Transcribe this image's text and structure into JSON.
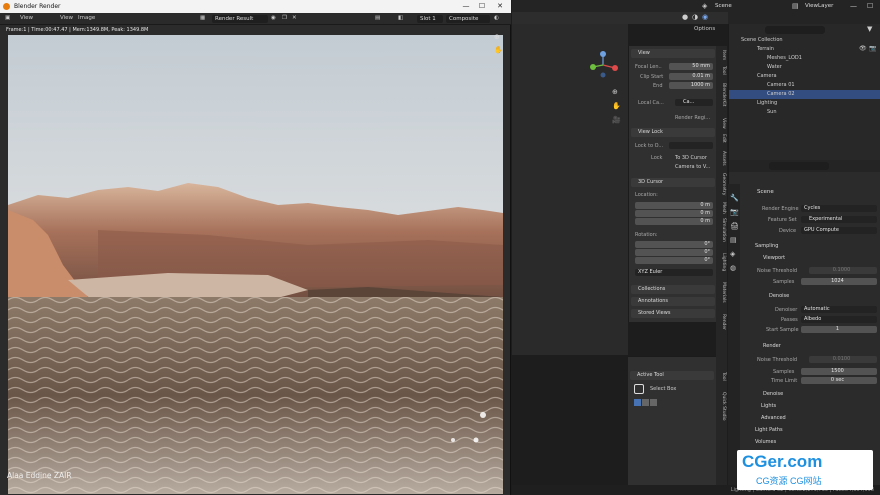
{
  "render_window": {
    "title": "Blender Render",
    "menu": {
      "view": "View",
      "view2": "View",
      "image": "Image"
    },
    "image_name": "Render Result",
    "slot": "Slot 1",
    "pass": "Composite",
    "info": "Frame:1 | Time:00:47.47 | Mem:1349.8M, Peak: 1349.8M",
    "credit": "Alaa Eddine ZAIR"
  },
  "topbar": {
    "scene": "Scene",
    "view_layer": "ViewLayer",
    "options": "Options"
  },
  "npanel": {
    "view_header": "View",
    "focal_label": "Focal Len..",
    "focal_value": "50 mm",
    "clip_start_label": "Clip Start",
    "clip_start_value": "0.01 m",
    "end_label": "End",
    "end_value": "1000 m",
    "local_camera_label": "Local Ca...",
    "local_camera_value": "Ca...",
    "render_region": "Render Regi...",
    "view_lock_header": "View Lock",
    "lock_to_object_label": "Lock to O...",
    "lock_label": "Lock",
    "lock_3d_cursor": "To 3D Cursor",
    "camera_to_view": "Camera to V...",
    "cursor_header": "3D Cursor",
    "location_label": "Location:",
    "loc_x": "0 m",
    "loc_y": "0 m",
    "loc_z": "0 m",
    "rotation_label": "Rotation:",
    "rot_x": "0°",
    "rot_y": "0°",
    "rot_z": "0°",
    "rotation_mode": "XYZ Euler",
    "collections": "Collections",
    "annotations": "Annotations",
    "stored_views": "Stored Views",
    "axis_x": "X",
    "axis_y": "Y",
    "axis_z": "Z"
  },
  "ntabs": [
    "Item",
    "Tool",
    "BlenderKit",
    "View",
    "Edit",
    "Assets",
    "Geometry",
    "Mesh",
    "Simulation",
    "Lighting",
    "Materials",
    "Render"
  ],
  "tool_panel": {
    "active_tool": "Active Tool",
    "select_box": "Select Box",
    "tabs": [
      "Tool",
      "Quick Studio"
    ]
  },
  "outliner": {
    "rows": [
      "Scene Collection",
      "Terrain",
      "Meshes_LOD1",
      "Water",
      "Camera",
      "Camera 01",
      "Camera 02",
      "Lighting",
      "Sun"
    ]
  },
  "properties": {
    "scene_name": "Scene",
    "render_engine_label": "Render Engine",
    "render_engine": "Cycles",
    "feature_set_label": "Feature Set",
    "feature_set": "Experimental",
    "device_label": "Device",
    "device": "GPU Compute",
    "sampling": "Sampling",
    "viewport": "Viewport",
    "noise_threshold_label": "Noise Threshold",
    "vp_noise_threshold": "0.1000",
    "samples_label": "Samples",
    "vp_samples": "1024",
    "denoise": "Denoise",
    "denoiser_label": "Denoiser",
    "denoiser": "Automatic",
    "passes_label": "Passes",
    "passes": "Albedo",
    "start_sample_label": "Start Sample",
    "start_sample": "1",
    "render": "Render",
    "r_noise_threshold": "0.0100",
    "r_samples": "1500",
    "time_limit_label": "Time Limit",
    "time_limit": "0 sec",
    "r_denoise": "Denoise",
    "light_tree": "Lights",
    "advanced": "Advanced",
    "light_paths": "Light Paths",
    "volumes": "Volumes"
  },
  "statusbar": "Lighting | Camera 02 | Verts:2,279,735 | Faces:4,554,998",
  "watermark": {
    "line1": "CGer.com",
    "line2": "CG资源 CG网站"
  },
  "colors": {
    "accent": "#4772b3",
    "selected_row": "#334d80",
    "sky_top": "#c6cfd6",
    "water": "#6d5c4c"
  }
}
